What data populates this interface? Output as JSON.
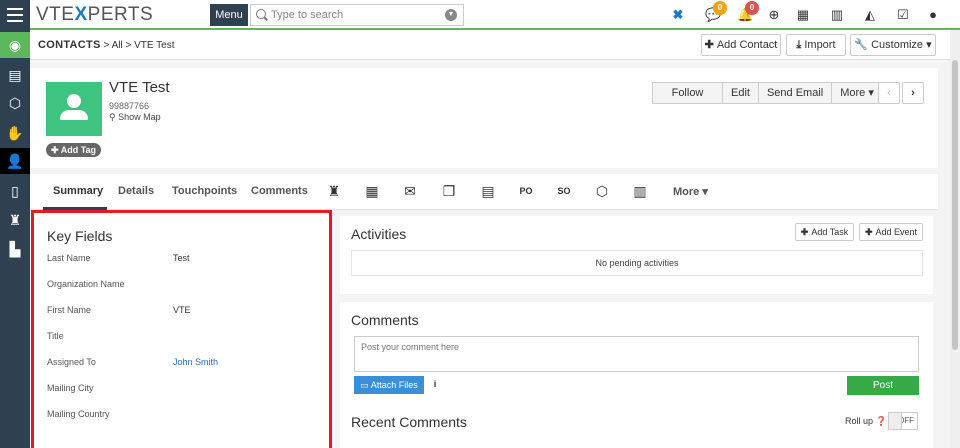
{
  "topbar": {
    "logo_pre": "VTE",
    "logo_x": "X",
    "logo_post": "PERTS",
    "menu_label": "Menu",
    "search_placeholder": "Type to search",
    "notifications": {
      "chat_count": "0",
      "alerts_count": "0"
    },
    "colors": {
      "accent": "#5cb85c",
      "sidebar": "#2f4050",
      "chat_badge": "#f0a30a",
      "alert_badge": "#d9534f"
    }
  },
  "sidebar": {
    "items": [
      {
        "icon": "home-circle-icon"
      },
      {
        "icon": "book-icon"
      },
      {
        "icon": "box-icon"
      },
      {
        "icon": "handshake-icon"
      },
      {
        "icon": "person-icon"
      },
      {
        "icon": "pages-icon"
      },
      {
        "icon": "money-bag-icon"
      },
      {
        "icon": "building-icon"
      }
    ]
  },
  "breadcrumb": {
    "module": "CONTACTS",
    "sep1": ">",
    "filter": "All",
    "sep2": ">",
    "record": "VTE Test"
  },
  "header_actions": {
    "add_contact": "Add Contact",
    "import": "Import",
    "customize": "Customize"
  },
  "record": {
    "name": "VTE Test",
    "phone": "99887766",
    "show_map": "Show Map",
    "add_tag": "Add Tag",
    "actions": [
      "Follow",
      "Edit",
      "Send Email",
      "More"
    ]
  },
  "tabs": {
    "items": [
      "Summary",
      "Details",
      "Touchpoints",
      "Comments"
    ],
    "more": "More",
    "icons": [
      "money-bag-icon",
      "calendar-icon",
      "envelope-icon",
      "documents-icon",
      "book-icon",
      "po-icon",
      "so-icon",
      "box-icon",
      "clipboard-icon"
    ]
  },
  "key_fields": {
    "title": "Key Fields",
    "rows": [
      {
        "label": "Last Name",
        "value": "Test"
      },
      {
        "label": "Organization Name",
        "value": ""
      },
      {
        "label": "First Name",
        "value": "VTE"
      },
      {
        "label": "Title",
        "value": ""
      },
      {
        "label": "Assigned To",
        "value": "John Smith"
      },
      {
        "label": "Mailing City",
        "value": ""
      },
      {
        "label": "Mailing Country",
        "value": ""
      }
    ]
  },
  "activities": {
    "title": "Activities",
    "add_task": "Add Task",
    "add_event": "Add Event",
    "empty": "No pending activities"
  },
  "comments": {
    "title": "Comments",
    "placeholder": "Post your comment here",
    "attach": "Attach Files",
    "post": "Post",
    "recent_title": "Recent Comments",
    "roll_up": "Roll up",
    "toggle": "OFF"
  }
}
